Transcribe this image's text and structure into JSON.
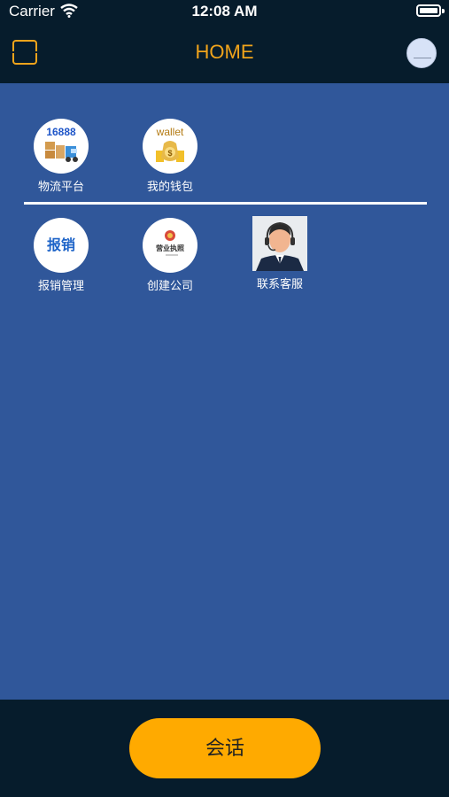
{
  "status_bar": {
    "carrier": "Carrier",
    "time": "12:08 AM"
  },
  "navbar": {
    "title": "HOME"
  },
  "grid": {
    "row1": [
      {
        "label": "物流平台",
        "icon": "logistics-truck-icon",
        "icon_text": "16888"
      },
      {
        "label": "我的钱包",
        "icon": "wallet-moneybag-icon",
        "icon_text": "wallet"
      }
    ],
    "row2": [
      {
        "label": "报销管理",
        "icon": "reimbursement-icon",
        "icon_text": "报销"
      },
      {
        "label": "创建公司",
        "icon": "business-license-icon",
        "icon_text": "营业执照"
      },
      {
        "label": "联系客服",
        "icon": "customer-service-agent-icon"
      }
    ]
  },
  "footer": {
    "chat_label": "会话"
  },
  "colors": {
    "accent": "#f0a41b",
    "main_bg": "#30579a",
    "dark_bg": "#061c2c",
    "button": "#ffaa00"
  }
}
